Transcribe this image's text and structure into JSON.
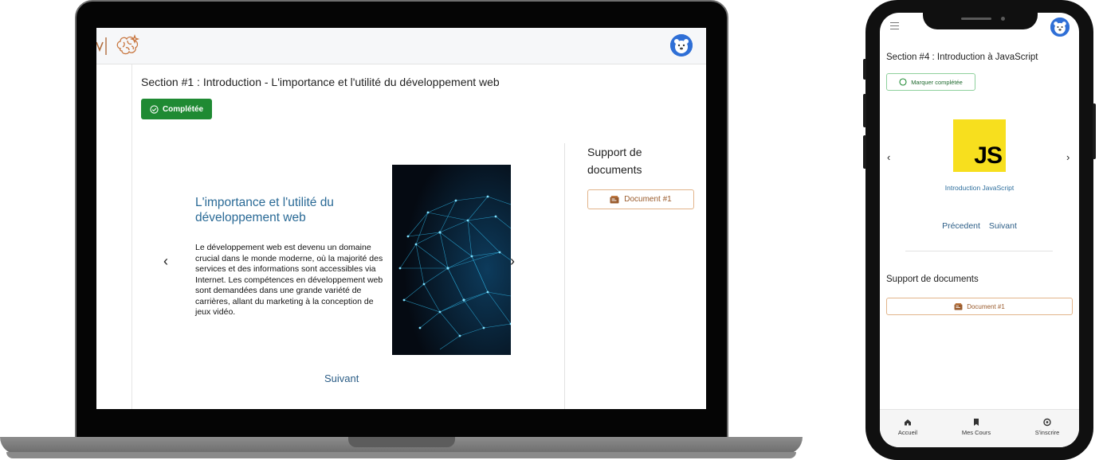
{
  "desktop": {
    "section_title": "Section #1 : Introduction - L'importance et l'utilité du développement web",
    "completed_label": "Complétée",
    "slide": {
      "heading": "L'importance et l'utilité du développement web",
      "body": "Le développement web est devenu un domaine crucial dans le monde moderne, où la majorité des services et des informations sont accessibles via Internet. Les compétences en développement web sont demandées dans une grande variété de carrières, allant du marketing à la conception de jeux vidéo.",
      "prev_icon": "chevron-left-icon",
      "next_icon": "chevron-right-icon"
    },
    "next_label": "Suivant",
    "support_title": "Support de documents",
    "document_label": "Document #1"
  },
  "mobile": {
    "section_title": "Section #4 : Introduction à JavaScript",
    "mark_label": "Marquer complétée",
    "js_logo_text": "JS",
    "slide_caption": "Introduction JavaScript",
    "prev_label": "Précedent",
    "next_label": "Suivant",
    "support_title": "Support de documents",
    "document_label": "Document #1",
    "bottom_nav": [
      {
        "label": "Accueil",
        "icon": "home-icon"
      },
      {
        "label": "Mes Cours",
        "icon": "bookmark-icon"
      },
      {
        "label": "S'inscrire",
        "icon": "circle-plus-icon"
      }
    ]
  },
  "colors": {
    "completed_green": "#1f8a33",
    "link_blue": "#2b5d86",
    "document_border": "#e2b48a",
    "js_yellow": "#f7df1e"
  }
}
